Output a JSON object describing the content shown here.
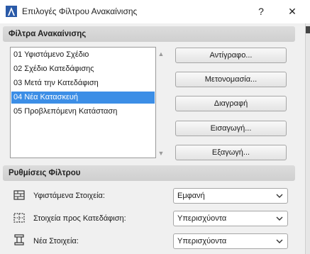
{
  "window": {
    "title": "Επιλογές Φίλτρου Ανακαίνισης",
    "help_label": "?",
    "close_label": "✕"
  },
  "filters_section": {
    "title": "Φίλτρα Ανακαίνισης",
    "items": [
      {
        "label": "01 Υφιστάμενο Σχέδιο",
        "selected": false
      },
      {
        "label": "02 Σχέδιο Κατεδάφισης",
        "selected": false
      },
      {
        "label": "03 Μετά την Κατεδάφιση",
        "selected": false
      },
      {
        "label": "04 Νέα Κατασκευή",
        "selected": true
      },
      {
        "label": "05 Προβλεπόμενη Κατάσταση",
        "selected": false
      }
    ],
    "buttons": {
      "duplicate": "Αντίγραφο...",
      "rename": "Μετονομασία...",
      "delete": "Διαγραφή",
      "import": "Εισαγωγή...",
      "export": "Εξαγωγή..."
    }
  },
  "settings_section": {
    "title": "Ρυθμίσεις Φίλτρου",
    "rows": [
      {
        "label": "Υφιστάμενα Στοιχεία:",
        "value": "Εμφανή",
        "icon": "existing-elements-icon"
      },
      {
        "label": "Στοιχεία προς Κατεδάφιση:",
        "value": "Υπερισχύοντα",
        "icon": "demolish-elements-icon"
      },
      {
        "label": "Νέα Στοιχεία:",
        "value": "Υπερισχύοντα",
        "icon": "new-elements-icon"
      }
    ]
  },
  "colors": {
    "selection": "#3c8ee6",
    "header_bg": "#d6d6d6",
    "window_bg": "#f0f0f0"
  }
}
